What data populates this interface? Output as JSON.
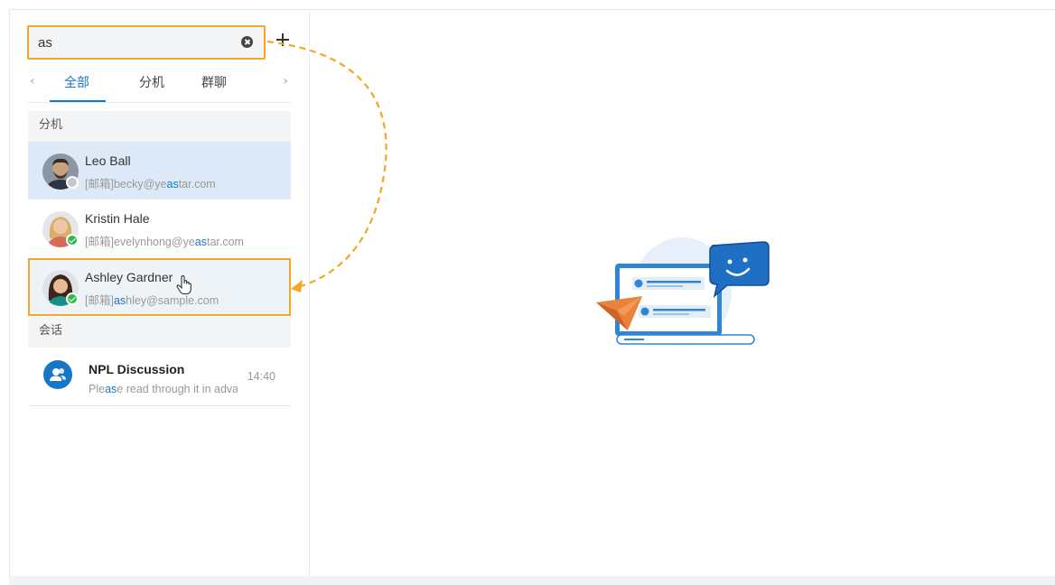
{
  "search": {
    "value": "as"
  },
  "tabs": [
    {
      "label": "全部",
      "active": true
    },
    {
      "label": "分机",
      "active": false
    },
    {
      "label": "群聊",
      "active": false
    }
  ],
  "sections": {
    "extensions": "分机",
    "conversations": "会话"
  },
  "contacts": [
    {
      "name": "Leo Ball",
      "sub_prefix": "[邮箱]becky@ye",
      "sub_hl": "as",
      "sub_suffix": "tar.com",
      "status": "offline"
    },
    {
      "name": "Kristin Hale",
      "sub_prefix": "[邮箱]evelynhong@ye",
      "sub_hl": "as",
      "sub_suffix": "tar.com",
      "status": "online"
    },
    {
      "name": "Ashley Gardner",
      "sub_prefix": "[邮箱]",
      "sub_hl": "as",
      "sub_suffix": "hley@sample.com",
      "status": "online"
    }
  ],
  "conversation": {
    "name": "NPL Discussion",
    "time": "14:40",
    "sub_prefix": "Ple",
    "sub_hl": "as",
    "sub_suffix": "e read through it in adva"
  },
  "colors": {
    "accent": "#1677c9",
    "highlight_border": "#f5a623",
    "online": "#2db84b"
  }
}
